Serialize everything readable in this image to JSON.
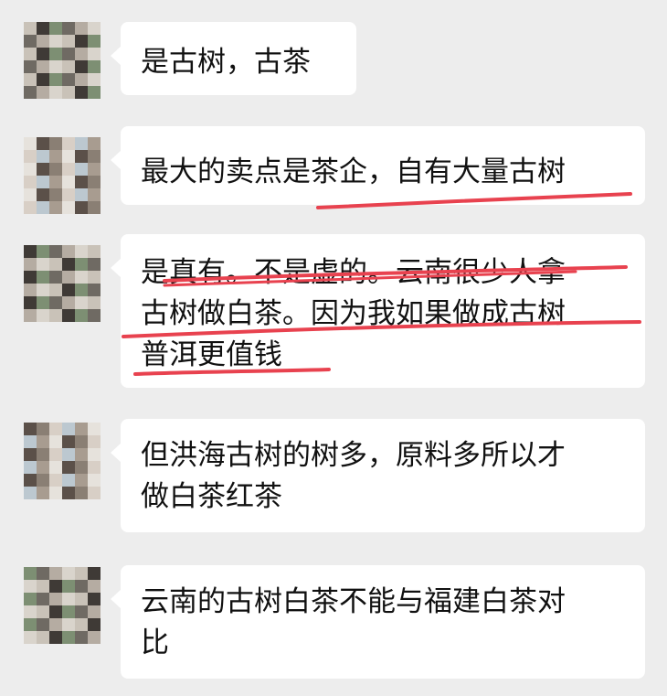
{
  "messages": [
    {
      "lines": [
        "是古树，古茶"
      ]
    },
    {
      "lines": [
        "最大的卖点是茶企，自有大量古树"
      ]
    },
    {
      "lines": [
        "是真有。不是虚的。云南很少人拿",
        "古树做白茶。因为我如果做成古树",
        "普洱更值钱"
      ]
    },
    {
      "lines": [
        "但洪海古树的树多，原料多所以才",
        "做白茶红茶"
      ]
    },
    {
      "lines": [
        "云南的古树白茶不能与福建白茶对",
        "比"
      ]
    }
  ],
  "colors": {
    "background": "#ededed",
    "bubble": "#ffffff",
    "text": "#111111",
    "highlight_underline": "#e8424f"
  },
  "icons": {
    "avatar": "pixelated-avatar-icon"
  }
}
